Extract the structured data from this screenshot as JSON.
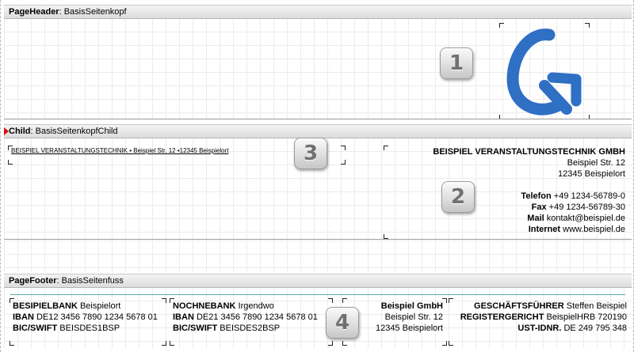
{
  "bands": {
    "page_header": {
      "type": "PageHeader",
      "name": "BasisSeitenkopf"
    },
    "child": {
      "type": "Child",
      "name": "BasisSeitenkopfChild"
    },
    "page_footer": {
      "type": "PageFooter",
      "name": "BasisSeitenfuss"
    }
  },
  "badges": [
    "1",
    "2",
    "3",
    "4"
  ],
  "logo": {
    "icon": "g-arrow-logo-icon",
    "color": "#2f6fc4"
  },
  "sender_line": "BEISPIEL VERANSTALTUNGSTECHNIK • Beispiel Str. 12 •12345 Beispielort",
  "address": {
    "company": "BEISPIEL VERANSTALTUNGSTECHNIK GMBH",
    "street": "Beispiel Str. 12",
    "city": "12345 Beispielort",
    "phone_label": "Telefon",
    "phone": "+49 1234-56789-0",
    "fax_label": "Fax",
    "fax": "+49 1234-56789-30",
    "mail_label": "Mail",
    "mail": "kontakt@beispiel.de",
    "internet_label": "Internet",
    "internet": "www.beispiel.de"
  },
  "footer": {
    "bank1": {
      "name_label": "BESIPIELBANK",
      "name": "Beispielort",
      "iban_label": "IBAN",
      "iban": "DE12 3456 7890 1234 5678 01",
      "bic_label": "BIC/SWIFT",
      "bic": "BEISDES1BSP"
    },
    "bank2": {
      "name_label": "NOCHNEBANK",
      "name": "Irgendwo",
      "iban_label": "IBAN",
      "iban": "DE21 3456 7890 1234 5678 01",
      "bic_label": "BIC/SWIFT",
      "bic": "BEISDES2BSP"
    },
    "company": {
      "name": "Beispiel GmbH",
      "street": "Beispiel Str. 12",
      "city": "12345 Beispielort"
    },
    "legal": {
      "ceo_label": "GESCHÄFTSFÜHRER",
      "ceo": "Steffen Beispiel",
      "register_label": "REGISTERGERICHT",
      "register": "BeispielHRB 720190",
      "vat_label": "UST-IDNR.",
      "vat": "DE 249 795 348"
    }
  }
}
